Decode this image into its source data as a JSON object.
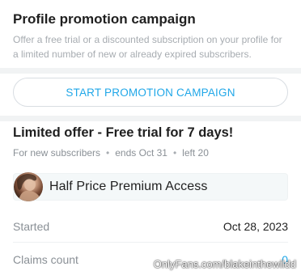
{
  "promotion": {
    "title": "Profile promotion campaign",
    "description": "Offer a free trial or a discounted subscription on your profile for a limited number of new or already expired subscribers.",
    "start_button_label": "START PROMOTION CAMPAIGN"
  },
  "offer": {
    "title": "Limited offer - Free trial for 7 days!",
    "audience": "For new subscribers",
    "ends": "ends Oct 31",
    "left": "left 20",
    "separator": "•",
    "plan_name": "Half Price Premium Access",
    "avatar_icon": "profile-avatar"
  },
  "details": {
    "started_label": "Started",
    "started_value": "Oct 28, 2023",
    "claims_label": "Claims count",
    "claims_value": "0"
  },
  "watermark": "OnlyFans.com/blakeinthewildd",
  "colors": {
    "accent": "#20a7e8",
    "muted_text": "#8a9096",
    "divider": "#f1f3f4"
  }
}
